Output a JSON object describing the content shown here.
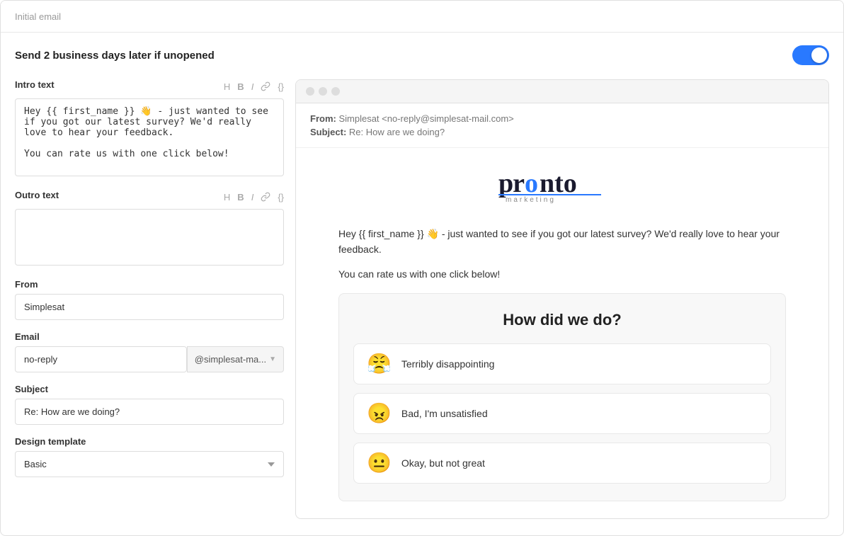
{
  "header": {
    "title": "Initial email"
  },
  "send_row": {
    "label": "Send 2 business days later if unopened",
    "toggle_on": true
  },
  "left_panel": {
    "intro_label": "Intro text",
    "intro_value": "Hey {{ first_name }} 👋 - just wanted to see if you got our latest survey? We'd really love to hear your feedback.\n\nYou can rate us with one click below!",
    "outro_label": "Outro text",
    "outro_value": "",
    "from_label": "From",
    "from_value": "Simplesat",
    "email_label": "Email",
    "email_prefix": "no-reply",
    "email_domain": "@simplesat-ma...",
    "subject_label": "Subject",
    "subject_value": "Re: How are we doing?",
    "design_label": "Design template",
    "design_value": "Basic",
    "toolbar": {
      "h_label": "H",
      "b_label": "B",
      "i_label": "I",
      "link_label": "🔗",
      "code_label": "{}"
    }
  },
  "email_preview": {
    "from_label": "From:",
    "from_value": "Simplesat <no-reply@simplesat-mail.com>",
    "subject_label": "Subject:",
    "subject_value": "Re: How are we doing?",
    "body_line1": "Hey {{ first_name }} 👋 - just wanted to see if you got our latest survey? We'd really love to hear your feedback.",
    "body_line2": "You can rate us with one click below!",
    "survey_title": "How did we do?",
    "options": [
      {
        "emoji": "😤",
        "label": "Terribly disappointing"
      },
      {
        "emoji": "😠",
        "label": "Bad, I'm unsatisfied"
      },
      {
        "emoji": "😐",
        "label": "Okay, but not great"
      }
    ]
  }
}
